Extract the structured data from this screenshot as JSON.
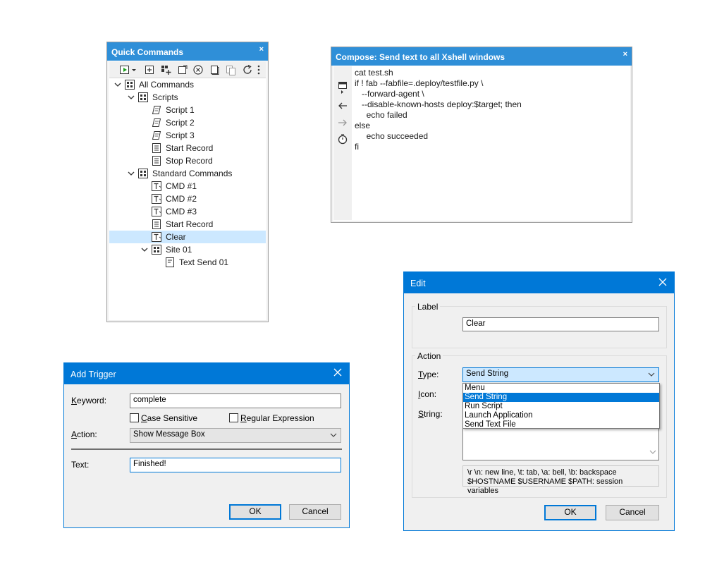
{
  "quick_commands": {
    "title": "Quick Commands",
    "close": "×",
    "toolbar": [
      "run-icon",
      "dropdown-arrow-icon",
      "add-icon",
      "add-group-icon",
      "edit-icon",
      "delete-icon",
      "copy-icon",
      "paste-icon",
      "refresh-icon",
      "more-icon"
    ],
    "tree": [
      {
        "label": "All Commands",
        "icon": "group-icon",
        "level": 0,
        "expanded": true
      },
      {
        "label": "Scripts",
        "icon": "group-icon",
        "level": 1,
        "expanded": true
      },
      {
        "label": "Script 1",
        "icon": "script-icon",
        "level": 2
      },
      {
        "label": "Script 2",
        "icon": "script-icon",
        "level": 2
      },
      {
        "label": "Script 3",
        "icon": "script-icon",
        "level": 2
      },
      {
        "label": "Start Record",
        "icon": "record-icon",
        "level": 2
      },
      {
        "label": "Stop Record",
        "icon": "record-icon",
        "level": 2
      },
      {
        "label": "Standard Commands",
        "icon": "list-icon",
        "level": 1,
        "expanded": true
      },
      {
        "label": "CMD #1",
        "icon": "text-cmd-icon",
        "level": 2
      },
      {
        "label": "CMD #2",
        "icon": "text-cmd-icon",
        "level": 2
      },
      {
        "label": "CMD #3",
        "icon": "text-cmd-icon",
        "level": 2
      },
      {
        "label": "Start Record",
        "icon": "record-icon",
        "level": 2
      },
      {
        "label": "Clear",
        "icon": "text-cmd-icon",
        "level": 2,
        "selected": true
      },
      {
        "label": "Site 01",
        "icon": "group-icon",
        "level": 2,
        "expanded": true
      },
      {
        "label": "Text Send 01",
        "icon": "text-file-icon",
        "level": 3
      }
    ]
  },
  "compose": {
    "title": "Compose: Send text to all Xshell windows",
    "close": "×",
    "side_icons": [
      "window-icon",
      "back-arrow-icon",
      "forward-arrow-icon",
      "timer-icon"
    ],
    "lines": [
      "cat test.sh",
      "if ! fab --fabfile=.deploy/testfile.py \\",
      "   --forward-agent \\",
      "   --disable-known-hosts deploy:$target; then",
      "     echo failed",
      "else",
      "     echo succeeded",
      "fi"
    ]
  },
  "add_trigger": {
    "title": "Add Trigger",
    "keyword_label_u": "K",
    "keyword_label_rest": "eyword:",
    "keyword_value": "complete",
    "case_sensitive_u": "C",
    "case_sensitive_rest": "ase Sensitive",
    "regex_u": "R",
    "regex_rest": "egular Expression",
    "action_label_u": "A",
    "action_label_rest": "ction:",
    "action_value": "Show Message Box",
    "text_label": "Text:",
    "text_value": "Finished!",
    "ok": "OK",
    "cancel": "Cancel"
  },
  "edit": {
    "title": "Edit",
    "label_group": "Label",
    "label_value": "Clear",
    "action_group": "Action",
    "type_label_u": "T",
    "type_label_rest": "ype:",
    "type_value": "Send String",
    "icon_label_u": "I",
    "icon_label_rest": "con:",
    "string_label_u": "S",
    "string_label_rest": "tring:",
    "type_options": [
      "Menu",
      "Send String",
      "Run Script",
      "Launch Application",
      "Send Text File"
    ],
    "type_selected_index": 1,
    "hint_line1": "\\r \\n: new line, \\t: tab, \\a: bell, \\b: backspace",
    "hint_line2": "$HOSTNAME $USERNAME $PATH: session variables",
    "ok": "OK",
    "cancel": "Cancel"
  },
  "colors": {
    "titlebar_light": "#2f8fd8",
    "titlebar_dialog": "#0078d7",
    "selection": "#cce8ff"
  }
}
